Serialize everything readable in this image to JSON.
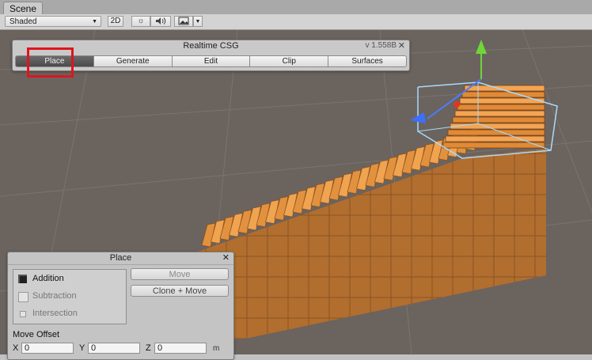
{
  "tab": {
    "label": "Scene"
  },
  "toolbar": {
    "shading_mode": "Shaded",
    "btn_2d": "2D",
    "icons": [
      "sun-icon",
      "speaker-icon",
      "image-icon",
      "chevron-down-icon"
    ]
  },
  "csg_window": {
    "title": "Realtime CSG",
    "version": "v 1.558B",
    "modes": [
      {
        "label": "Place",
        "active": true
      },
      {
        "label": "Generate",
        "active": false
      },
      {
        "label": "Edit",
        "active": false
      },
      {
        "label": "Clip",
        "active": false
      },
      {
        "label": "Surfaces",
        "active": false
      }
    ]
  },
  "place_panel": {
    "title": "Place",
    "operations": [
      {
        "label": "Addition",
        "selected": true
      },
      {
        "label": "Subtraction",
        "selected": false
      },
      {
        "label": "Intersection",
        "selected": false
      }
    ],
    "move_label": "Move",
    "clone_move_label": "Clone + Move",
    "move_offset": {
      "label": "Move Offset",
      "x_label": "X",
      "x_value": "0",
      "y_label": "Y",
      "y_value": "0",
      "z_label": "Z",
      "z_value": "0",
      "unit": "m"
    }
  },
  "colors": {
    "scene_bg": "#6b635e",
    "brush_orange": "#e89a4a",
    "selection_outline": "#9fd4ff",
    "highlight_red": "#e0141e"
  }
}
